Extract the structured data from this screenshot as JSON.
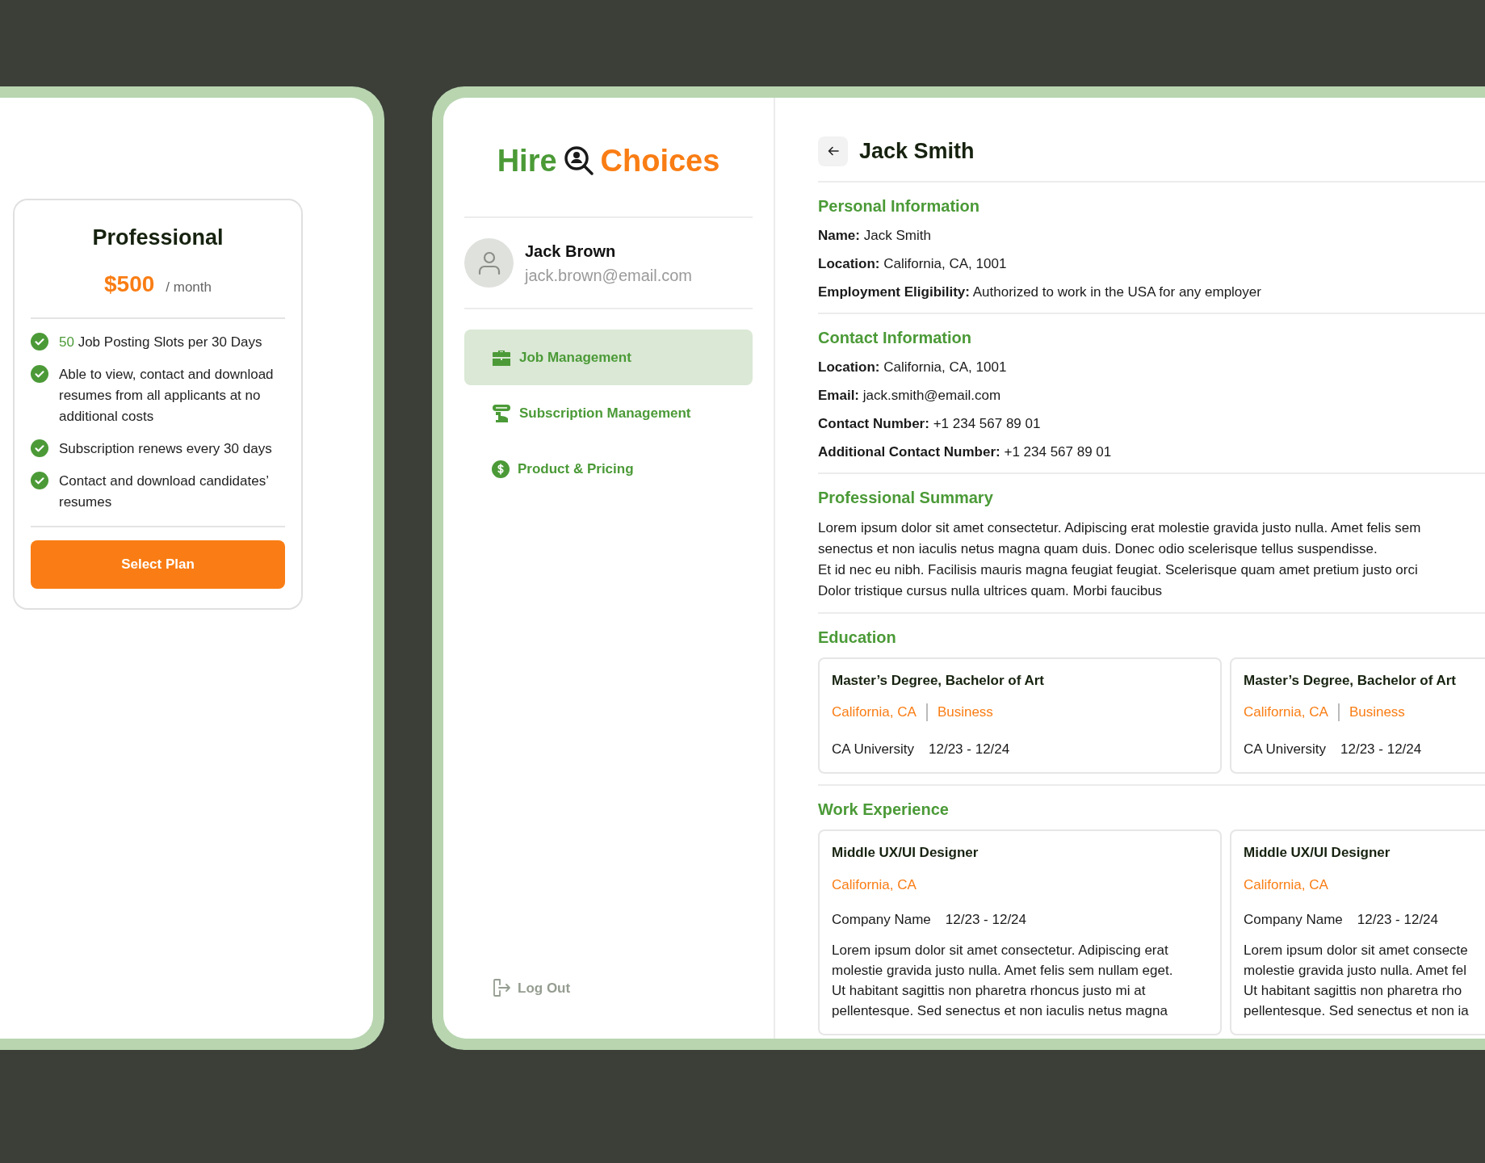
{
  "pricing_card": {
    "plan": "Professional",
    "price": "$500",
    "period": "/ month",
    "features": [
      {
        "highlight": "50",
        "text": "Job Posting Slots per 30 Days"
      },
      {
        "text": "Able to view, contact and download resumes from all applicants at no additional costs"
      },
      {
        "text": "Subscription renews every 30 days"
      },
      {
        "text": "Contact and download candidates’ resumes"
      }
    ],
    "button": "Select Plan"
  },
  "sidebar": {
    "logo": {
      "first_word": "Hire",
      "second_word": "Choices"
    },
    "user": {
      "name": "Jack Brown",
      "email": "jack.brown@email.com"
    },
    "nav": [
      {
        "label": "Job Management",
        "selected": true
      },
      {
        "label": "Subscription Management",
        "selected": false
      },
      {
        "label": "Product & Pricing",
        "selected": false
      }
    ],
    "logout": "Log Out"
  },
  "profile": {
    "title": "Jack Smith",
    "sections": [
      {
        "kind": "fields",
        "heading": "Personal Information",
        "fields": [
          {
            "label": "Name:",
            "value": "Jack Smith"
          },
          {
            "label": "Location:",
            "value": "California, CA, 1001"
          },
          {
            "label": "Employment Eligibility:",
            "value": "Authorized to work in the USA for any employer"
          }
        ]
      },
      {
        "kind": "fields",
        "heading": "Contact Information",
        "fields": [
          {
            "label": "Location:",
            "value": "California, CA, 1001"
          },
          {
            "label": "Email:",
            "value": "jack.smith@email.com"
          },
          {
            "label": "Contact Number:",
            "value": "+1 234 567 89 01"
          },
          {
            "label": "Additional Contact Number:",
            "value": "+1 234 567 89 01"
          }
        ]
      },
      {
        "kind": "paragraph",
        "heading": "Professional Summary",
        "lines": [
          "Lorem ipsum dolor sit amet consectetur. Adipiscing erat molestie gravida justo nulla. Amet felis sem",
          "senectus et non iaculis netus magna quam duis. Donec odio scelerisque tellus suspendisse.",
          "Et id nec eu nibh. Facilisis mauris magna feugiat feugiat. Scelerisque quam amet pretium justo orci",
          "Dolor tristique cursus nulla ultrices quam. Morbi faucibus"
        ]
      },
      {
        "kind": "education",
        "heading": "Education",
        "cards": [
          {
            "title": "Master’s Degree, Bachelor of Art",
            "location": "California, CA",
            "field": "Business",
            "school": "CA University",
            "dates": "12/23 - 12/24"
          },
          {
            "title": "Master’s Degree, Bachelor of Art",
            "location": "California, CA",
            "field": "Business",
            "school": "CA University",
            "dates": "12/23 - 12/24"
          }
        ]
      },
      {
        "kind": "work",
        "heading": "Work Experience",
        "cards": [
          {
            "title": "Middle UX/UI Designer",
            "location": "California, CA",
            "company": "Company Name",
            "dates": "12/23 - 12/24",
            "lines": [
              "Lorem ipsum dolor sit amet consectetur. Adipiscing erat",
              "molestie gravida justo nulla. Amet felis sem nullam eget.",
              "Ut habitant sagittis non pharetra rhoncus justo mi at",
              "pellentesque. Sed senectus et non iaculis netus magna"
            ]
          },
          {
            "title": "Middle UX/UI Designer",
            "location": "California, CA",
            "company": "Company Name",
            "dates": "12/23 - 12/24",
            "lines": [
              "Lorem ipsum dolor sit amet consecte",
              "molestie gravida justo nulla. Amet fel",
              "Ut habitant sagittis non pharetra rho",
              "pellentesque. Sed senectus et non ia"
            ]
          }
        ]
      }
    ]
  }
}
